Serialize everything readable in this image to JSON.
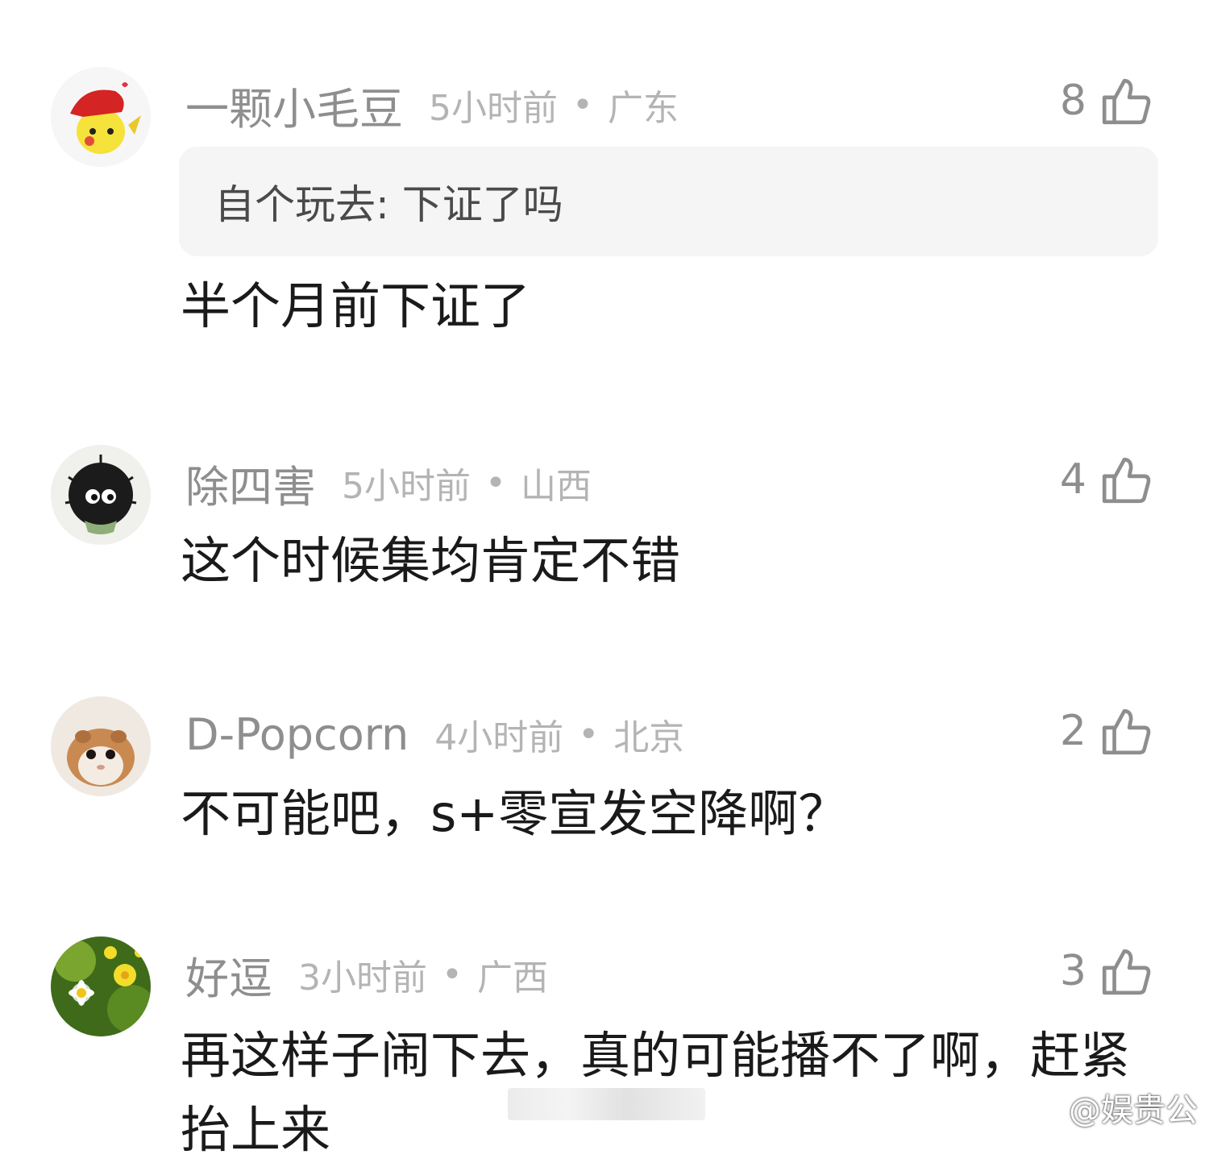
{
  "comments": [
    {
      "username": "一颗小毛豆",
      "time": "5小时前",
      "separator": "•",
      "region": "广东",
      "likes": "8",
      "quote": "自个玩去: 下证了吗",
      "content": "半个月前下证了"
    },
    {
      "username": "除四害",
      "time": "5小时前",
      "separator": "•",
      "region": "山西",
      "likes": "4",
      "content": "这个时候集均肯定不错"
    },
    {
      "username": "D-Popcorn",
      "time": "4小时前",
      "separator": "•",
      "region": "北京",
      "likes": "2",
      "content": "不可能吧，s+零宣发空降啊？"
    },
    {
      "username": "好逗",
      "time": "3小时前",
      "separator": "•",
      "region": "广西",
      "likes": "3",
      "content": "再这样子闹下去，真的可能播不了啊，赶紧抬上来"
    }
  ],
  "watermark": {
    "text": "@娱贵公",
    "icon": "weibo-icon"
  },
  "icons": {
    "like": "thumbs-up-icon"
  }
}
